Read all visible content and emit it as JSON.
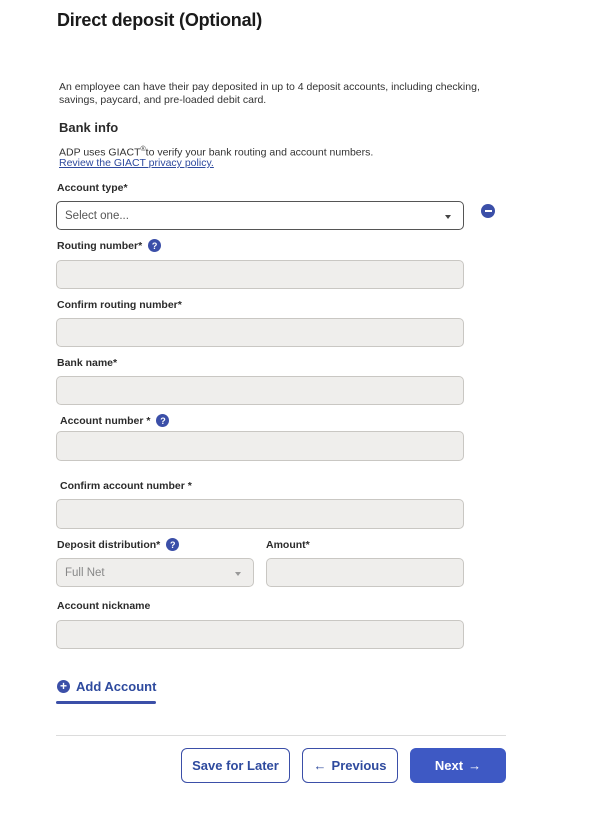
{
  "page": {
    "title": "Direct deposit (Optional)",
    "intro": "An employee can have their pay deposited in up to 4 deposit accounts, including checking, savings, paycard, and pre-loaded debit card."
  },
  "bank_info": {
    "heading": "Bank info",
    "giact_text_before": "ADP uses GIACT",
    "giact_sup": "®",
    "giact_text_after": "to verify your bank routing and account numbers.",
    "giact_link": "Review the GIACT privacy policy."
  },
  "fields": {
    "account_type": {
      "label": "Account type*",
      "value": "Select one..."
    },
    "routing_number": {
      "label": "Routing number*",
      "value": ""
    },
    "confirm_routing_number": {
      "label": "Confirm routing number*",
      "value": ""
    },
    "bank_name": {
      "label": "Bank name*",
      "value": ""
    },
    "account_number": {
      "label": "Account number *",
      "value": ""
    },
    "confirm_account_number": {
      "label": "Confirm account number *",
      "value": ""
    },
    "deposit_distribution": {
      "label": "Deposit distribution*",
      "value": "Full Net"
    },
    "amount": {
      "label": "Amount*",
      "value": ""
    },
    "account_nickname": {
      "label": "Account nickname",
      "value": ""
    }
  },
  "icons": {
    "help": "?",
    "add": "+",
    "remove": "minus-circle-icon"
  },
  "actions": {
    "add_account": "Add Account",
    "save_for_later": "Save for Later",
    "previous": "Previous",
    "previous_arrow": "←",
    "next": "Next",
    "next_arrow": "→"
  },
  "colors": {
    "accent": "#3b4fa8",
    "primary_button": "#3e59c4",
    "input_bg": "#efeeec"
  }
}
